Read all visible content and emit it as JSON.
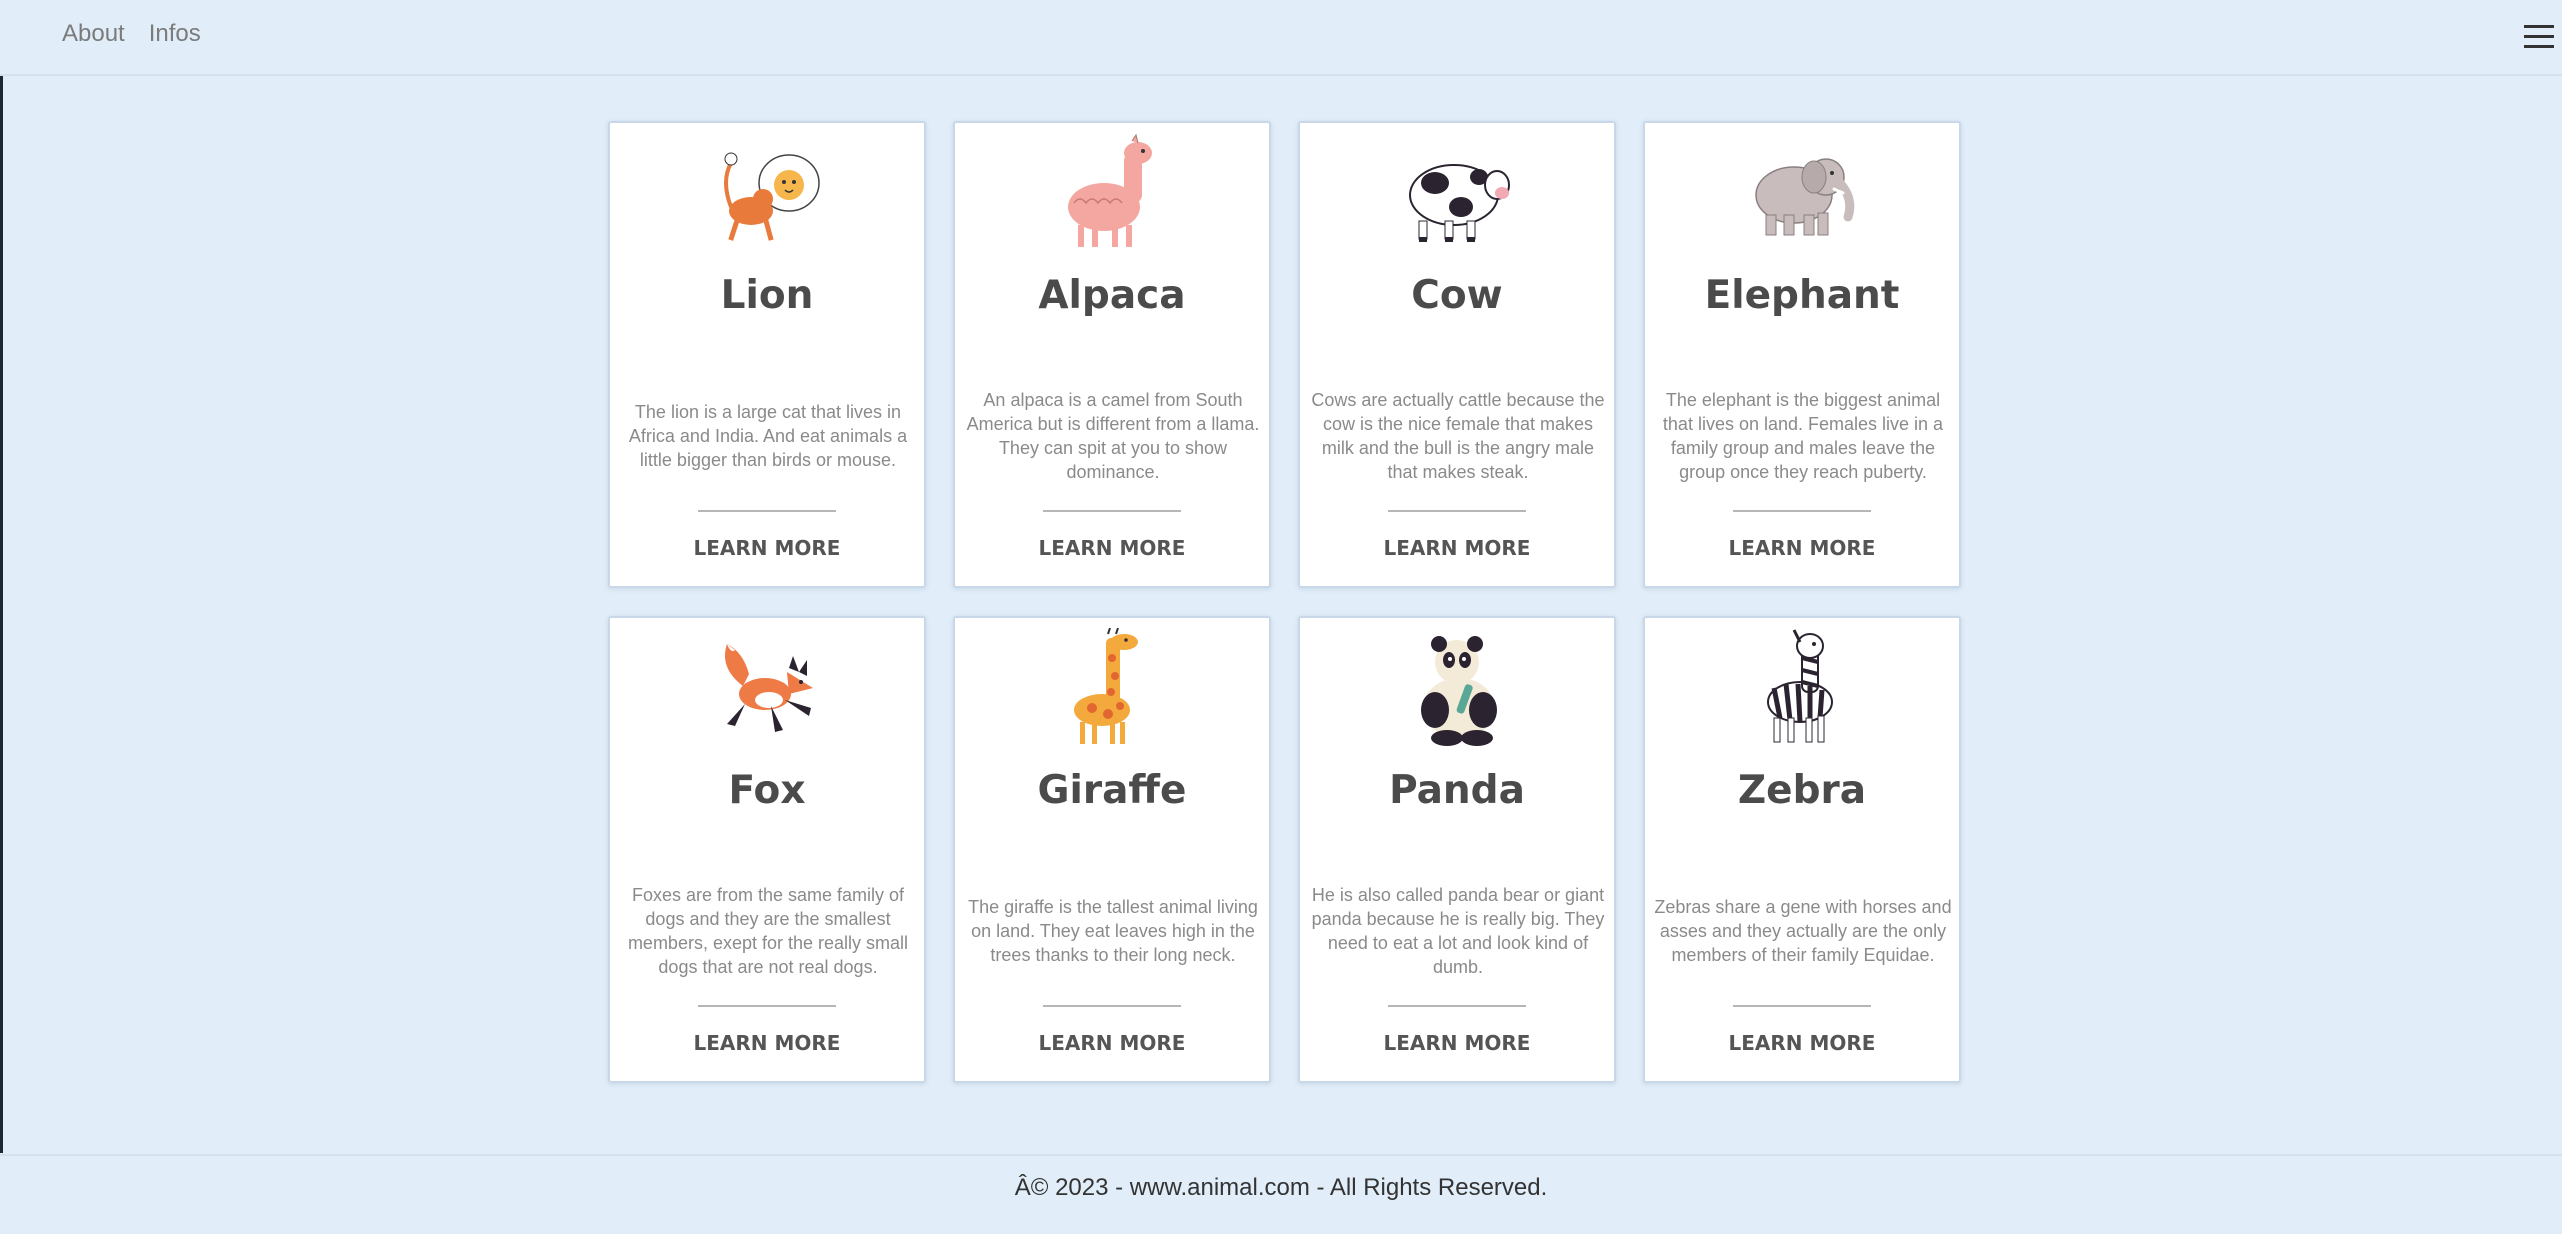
{
  "nav": {
    "links": [
      "About",
      "Infos"
    ]
  },
  "cards": [
    {
      "title": "Lion",
      "desc": "The lion is a large cat that lives in Africa and India. And eat animals a little bigger than birds or mouse.",
      "cta": "LEARN MORE",
      "icon": "lion-icon"
    },
    {
      "title": "Alpaca",
      "desc": "An alpaca is a camel from South America but is different from a llama. They can spit at you to show dominance.",
      "cta": "LEARN MORE",
      "icon": "alpaca-icon"
    },
    {
      "title": "Cow",
      "desc": "Cows are actually cattle because the cow is the nice female that makes milk and the bull is the angry male that makes steak.",
      "cta": "LEARN MORE",
      "icon": "cow-icon"
    },
    {
      "title": "Elephant",
      "desc": "The elephant is the biggest animal that lives on land. Females live in a family group and males leave the group once they reach puberty.",
      "cta": "LEARN MORE",
      "icon": "elephant-icon"
    },
    {
      "title": "Fox",
      "desc": "Foxes are from the same family of dogs and they are the smallest members, exept for the really small dogs that are not real dogs.",
      "cta": "LEARN MORE",
      "icon": "fox-icon"
    },
    {
      "title": "Giraffe",
      "desc": "The giraffe is the tallest animal living on land. They eat leaves high in the trees thanks to their long neck.",
      "cta": "LEARN MORE",
      "icon": "giraffe-icon"
    },
    {
      "title": "Panda",
      "desc": "He is also called panda bear or giant panda because he is really big. They need to eat a lot and look kind of dumb.",
      "cta": "LEARN MORE",
      "icon": "panda-icon"
    },
    {
      "title": "Zebra",
      "desc": "Zebras share a gene with horses and asses and they actually are the only members of their family Equidae.",
      "cta": "LEARN MORE",
      "icon": "zebra-icon"
    }
  ],
  "footer": {
    "text": "Â© 2023 - www.animal.com - All Rights Reserved."
  },
  "colors": {
    "background": "#e1edf8",
    "card": "#ffffff",
    "title": "#4b4b4b",
    "description": "#8a8a8a"
  }
}
